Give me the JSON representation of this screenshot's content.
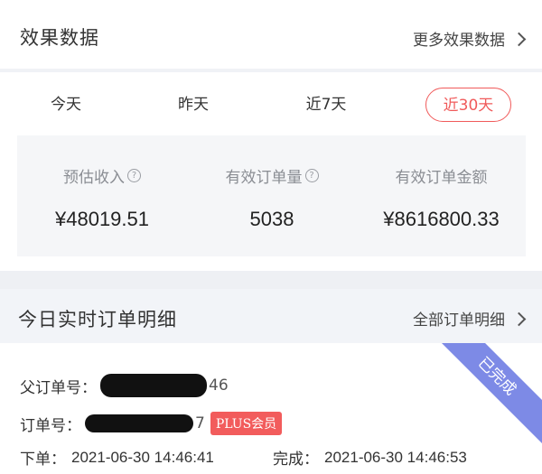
{
  "effects": {
    "title": "效果数据",
    "more_label": "更多效果数据"
  },
  "tabs": [
    {
      "label": "今天",
      "active": false
    },
    {
      "label": "昨天",
      "active": false
    },
    {
      "label": "近7天",
      "active": false
    },
    {
      "label": "近30天",
      "active": true
    }
  ],
  "stats": [
    {
      "label": "预估收入",
      "has_help": true,
      "value": "¥48019.51"
    },
    {
      "label": "有效订单量",
      "has_help": true,
      "value": "5038"
    },
    {
      "label": "有效订单金额",
      "has_help": false,
      "value": "¥8616800.33"
    }
  ],
  "orders_section": {
    "title": "今日实时订单明细",
    "more_label": "全部订单明细"
  },
  "order": {
    "status": "已完成",
    "parent_order_label": "父订单号：",
    "parent_order_tail": "46",
    "order_label": "订单号：",
    "order_tail": "7",
    "badge": "PLUS会员",
    "placed_label": "下单：",
    "placed_time": "2021-06-30 14:46:41",
    "done_label": "完成：",
    "done_time": "2021-06-30 14:46:53"
  },
  "colors": {
    "accent": "#f05a5a",
    "ribbon": "#7d8ae6"
  }
}
